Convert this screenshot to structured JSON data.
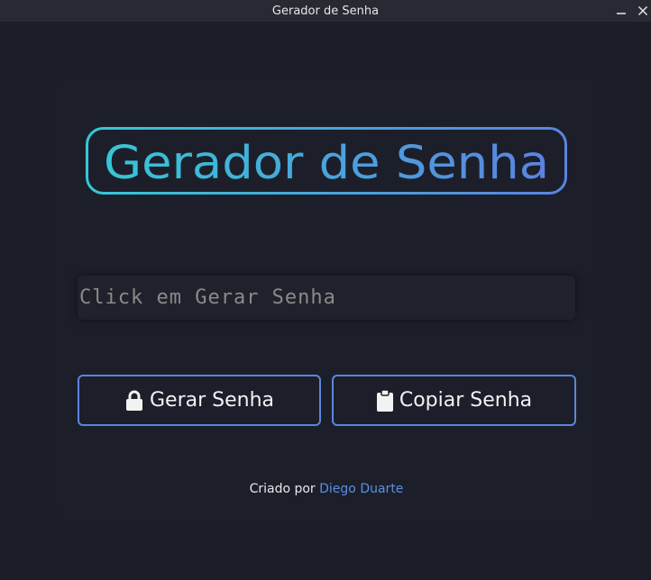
{
  "window": {
    "title": "Gerador de Senha",
    "minimize_icon": "minimize-icon",
    "close_icon": "close-icon"
  },
  "header": {
    "logo_text": "Gerador de Senha",
    "gradient_colors": [
      "#36c7d6",
      "#5b83e0"
    ]
  },
  "password": {
    "value": "",
    "placeholder": "Click em Gerar Senha"
  },
  "buttons": {
    "generate": {
      "label": "Gerar Senha",
      "icon": "lock-icon"
    },
    "copy": {
      "label": "Copiar Senha",
      "icon": "clipboard-icon"
    }
  },
  "footer": {
    "prefix": "Criado por",
    "author": "Diego Duarte"
  },
  "colors": {
    "background": "#1b1e28",
    "accent": "#5b85dc",
    "link": "#5b8fe0"
  }
}
